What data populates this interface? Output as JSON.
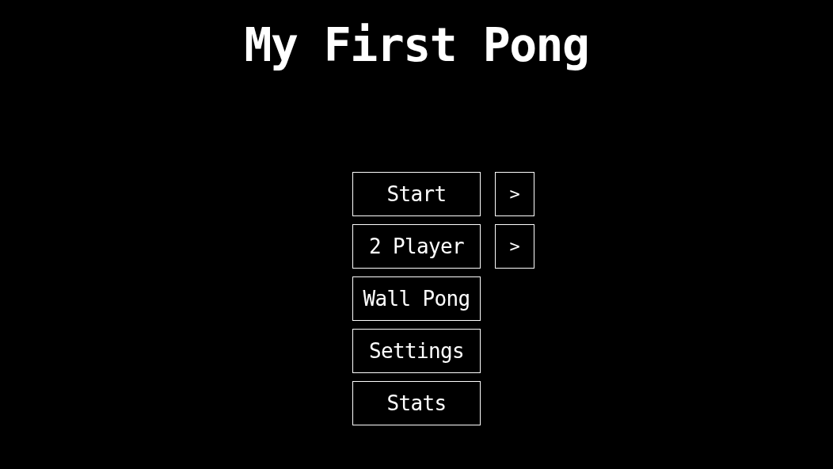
{
  "title": "My First Pong",
  "menu": [
    {
      "label": "Start",
      "arrow": ">"
    },
    {
      "label": "2 Player",
      "arrow": ">"
    },
    {
      "label": "Wall Pong"
    },
    {
      "label": "Settings"
    },
    {
      "label": "Stats"
    }
  ]
}
